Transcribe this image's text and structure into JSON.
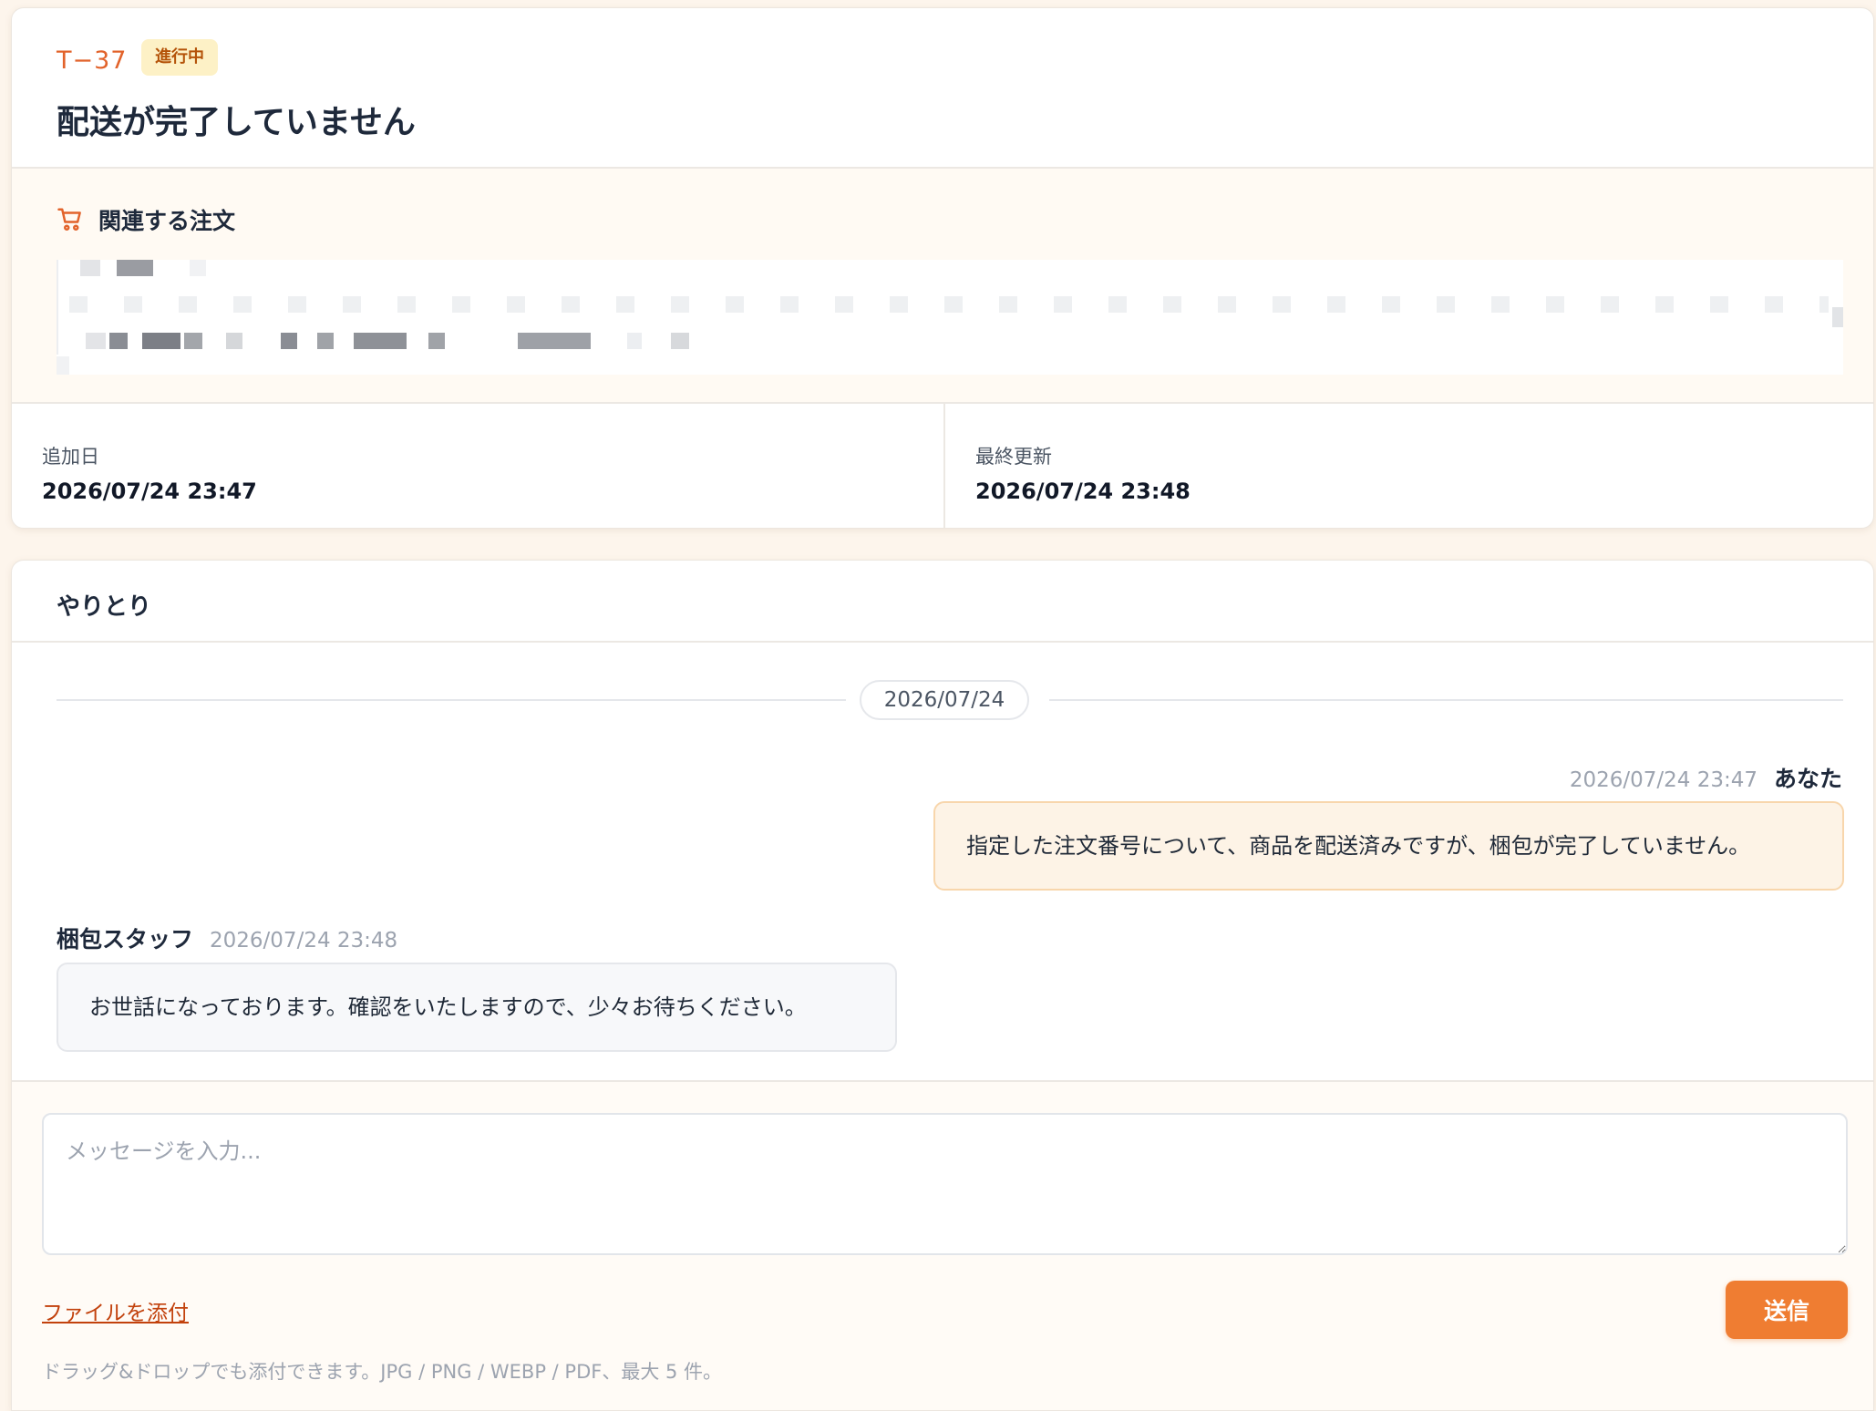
{
  "ticket": {
    "id": "T−37",
    "status": "進行中",
    "title": "配送が完了していません"
  },
  "order": {
    "heading": "関連する注文",
    "icon": "cart-icon"
  },
  "meta": {
    "added_label": "追加日",
    "added_value": "2026/07/24 23:47",
    "updated_label": "最終更新",
    "updated_value": "2026/07/24 23:48"
  },
  "conversation": {
    "title": "やりとり",
    "date_divider": "2026/07/24",
    "messages": [
      {
        "sender": "あなた",
        "time": "2026/07/24 23:47",
        "text": "指定した注文番号について、商品を配送済みですが、梱包が完了していません。"
      },
      {
        "sender": "梱包スタッフ",
        "time": "2026/07/24 23:48",
        "text": "お世話になっております。確認をいたしますので、少々お待ちください。"
      }
    ]
  },
  "composer": {
    "placeholder": "メッセージを入力...",
    "attach_label": "ファイルを添付",
    "send_label": "送信",
    "hint": "ドラッグ&ドロップでも添付できます。JPG / PNG / WEBP / PDF、最大 5 件。"
  },
  "colors": {
    "accent": "#ef7d32",
    "ticket_id": "#e2632b",
    "badge_bg": "#fdf1c6",
    "badge_text": "#b45309",
    "own_bubble_bg": "#fdf3e6",
    "own_bubble_border": "#f8d6ac",
    "link": "#c2410c"
  }
}
